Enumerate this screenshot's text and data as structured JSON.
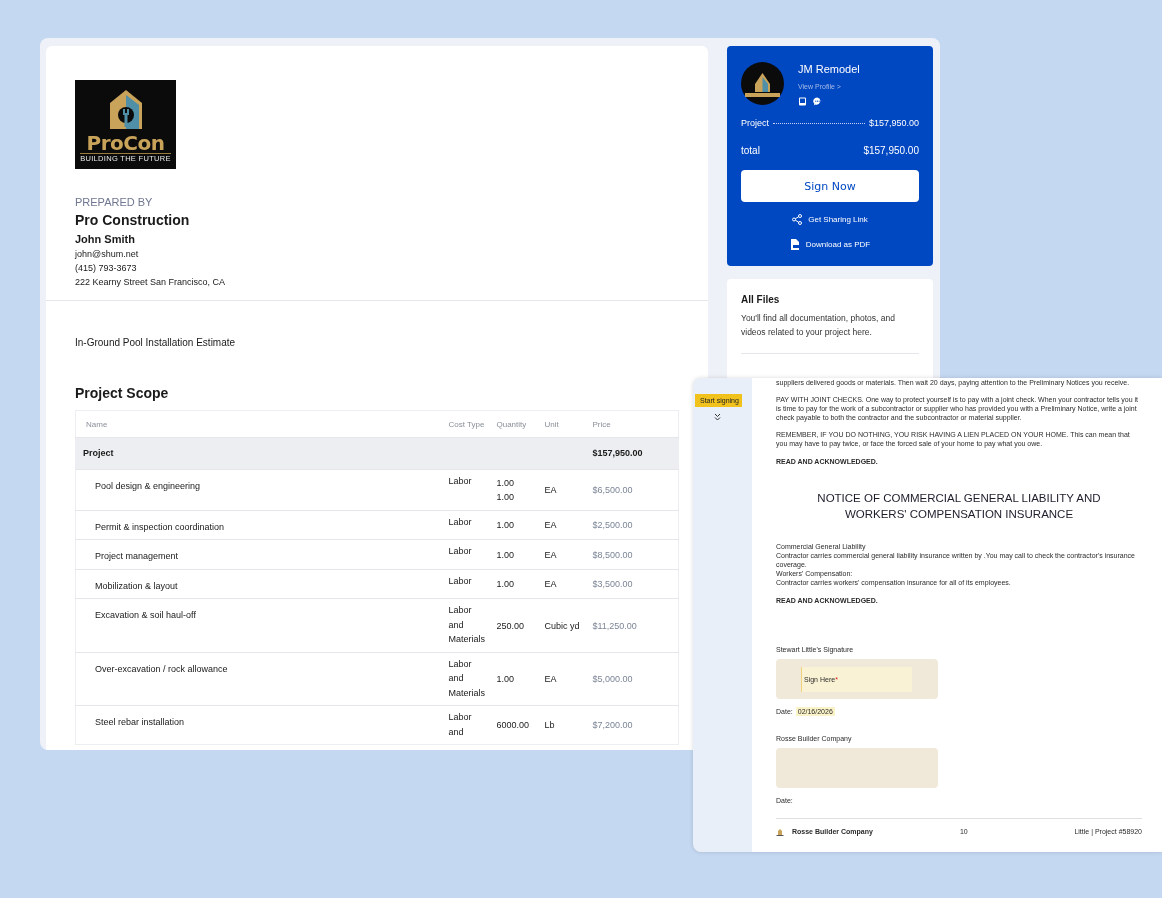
{
  "logo": {
    "name": "ProCon",
    "tagline": "BUILDING THE FUTURE"
  },
  "prepared_by": {
    "label": "PREPARED BY",
    "company": "Pro Construction",
    "person": "John Smith",
    "email": "john@shum.net",
    "phone": "(415) 793-3673",
    "address": "222 Kearny Street San Francisco, CA"
  },
  "estimate_title": "In-Ground Pool Installation Estimate",
  "scope": {
    "title": "Project Scope",
    "columns": [
      "Name",
      "Cost Type",
      "Quantity",
      "Unit",
      "Price"
    ],
    "group": {
      "name": "Project",
      "price": "$157,950.00"
    },
    "rows": [
      {
        "name": "Pool design & engineering",
        "cost_type": "Labor",
        "quantity": [
          "1.00",
          "1.00"
        ],
        "unit": "EA",
        "price": "$6,500.00"
      },
      {
        "name": "Permit & inspection coordination",
        "cost_type": "Labor",
        "quantity": [
          "1.00"
        ],
        "unit": "EA",
        "price": "$2,500.00"
      },
      {
        "name": "Project management",
        "cost_type": "Labor",
        "quantity": [
          "1.00"
        ],
        "unit": "EA",
        "price": "$8,500.00"
      },
      {
        "name": "Mobilization & layout",
        "cost_type": "Labor",
        "quantity": [
          "1.00"
        ],
        "unit": "EA",
        "price": "$3,500.00"
      },
      {
        "name": "Excavation & soil haul-off",
        "cost_type": "Labor and Materials",
        "quantity": [
          "250.00"
        ],
        "unit": "Cubic yd",
        "price": "$11,250.00"
      },
      {
        "name": "Over-excavation / rock allowance",
        "cost_type": "Labor and Materials",
        "quantity": [
          "1.00"
        ],
        "unit": "EA",
        "price": "$5,000.00"
      },
      {
        "name": "Steel rebar installation",
        "cost_type": "Labor and",
        "quantity": [
          "6000.00"
        ],
        "unit": "Lb",
        "price": "$7,200.00"
      }
    ]
  },
  "contractor_card": {
    "name": "JM Remodel",
    "profile_link": "View Profile >",
    "lines": [
      {
        "label": "Project",
        "amount": "$157,950.00",
        "kind": "dotted"
      },
      {
        "label": "total",
        "amount": "$157,950.00",
        "kind": "plain"
      }
    ],
    "sign_button": "Sign Now",
    "actions": [
      {
        "label": "Get Sharing Link",
        "kind": "share"
      },
      {
        "label": "Download as PDF",
        "kind": "download"
      }
    ]
  },
  "files_card": {
    "title": "All Files",
    "description": "You'll find all documentation, photos, and videos related to your project here."
  },
  "signing_panel": {
    "start_tag": "Start signing",
    "paragraphs": [
      {
        "kind": "para",
        "lines": [
          "suppliers delivered goods or materials. Then wait 20 days, paying attention to the Preliminary Notices you receive."
        ]
      },
      {
        "kind": "para",
        "lines": [
          "PAY WITH JOINT CHECKS. One way to protect yourself is to pay with a joint check. When your contractor tells you it is time to pay for the work of a subcontractor or supplier who has provided you with a Preliminary Notice, write a joint check payable to both the contractor and the subcontractor or material supplier."
        ]
      },
      {
        "kind": "para",
        "lines": [
          "REMEMBER, IF YOU DO NOTHING, YOU RISK HAVING A LIEN PLACED ON YOUR HOME. This can mean that you may have to pay twice, or face the forced sale of your home to pay what you owe."
        ]
      },
      {
        "kind": "bold",
        "lines": [
          "READ AND ACKNOWLEDGED."
        ]
      },
      {
        "kind": "heading",
        "lines": [
          "NOTICE OF COMMERCIAL GENERAL LIABILITY AND WORKERS' COMPENSATION INSURANCE"
        ]
      },
      {
        "kind": "para",
        "lines": [
          "Commercial General Liability",
          "Contractor carries commercial general liability insurance written by    .You may call    to check the contractor's insurance coverage.",
          "Workers' Compensation:",
          "Contractor carries workers' compensation insurance for all of its employees."
        ]
      },
      {
        "kind": "bold",
        "lines": [
          "READ AND ACKNOWLEDGED."
        ]
      }
    ],
    "signatures": [
      {
        "label": "Stewart Little's Signature",
        "sign_label": "Sign Here",
        "required_mark": "*",
        "date_label": "Date:",
        "date_value": "02/16/2026"
      },
      {
        "label": "Rosse Builder Company",
        "date_label": "Date:"
      }
    ],
    "footer": {
      "company": "Rosse Builder Company",
      "page": "10",
      "project": "Little | Project #58920"
    }
  }
}
